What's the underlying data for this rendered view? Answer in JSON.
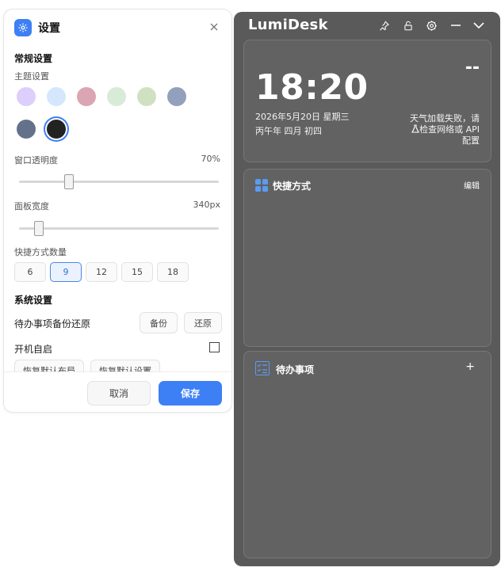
{
  "settings": {
    "title": "设置",
    "general_section": "常规设置",
    "theme_label": "主题设置",
    "theme_swatches": [
      "#dccffb",
      "#d4e7fc",
      "#dba5b3",
      "#d8ebd7",
      "#d0e1c2",
      "#93a0bd",
      "#64718a",
      "#222222"
    ],
    "selected_theme_index": 7,
    "opacity_label": "窗口透明度",
    "opacity_value": "70%",
    "opacity_fraction": 0.25,
    "width_label": "面板宽度",
    "width_value": "340px",
    "width_fraction": 0.1,
    "shortcut_count_label": "快捷方式数量",
    "shortcut_counts": [
      "6",
      "9",
      "12",
      "15",
      "18"
    ],
    "selected_count_index": 1,
    "system_section": "系统设置",
    "backup_label": "待办事项备份还原",
    "backup_button": "备份",
    "restore_button": "还原",
    "autostart_label": "开机自启",
    "autostart_checked": false,
    "reset_layout_button": "恢复默认布局",
    "reset_settings_button": "恢复默认设置",
    "cancel_button": "取消",
    "save_button": "保存",
    "accent_color": "#3d7ff5"
  },
  "lumidesk": {
    "app_title": "LumiDesk",
    "clock": {
      "time": "18:20",
      "date": "2026年5月20日 星期三",
      "lunar": "丙午年 四月 初四",
      "temperature": "--",
      "weather_error": "天气加载失败，请检查网络或 API 配置"
    },
    "shortcuts": {
      "title": "快捷方式",
      "edit": "编辑"
    },
    "todo": {
      "title": "待办事项",
      "add": "+"
    },
    "background_color": "#5a5a5a"
  }
}
